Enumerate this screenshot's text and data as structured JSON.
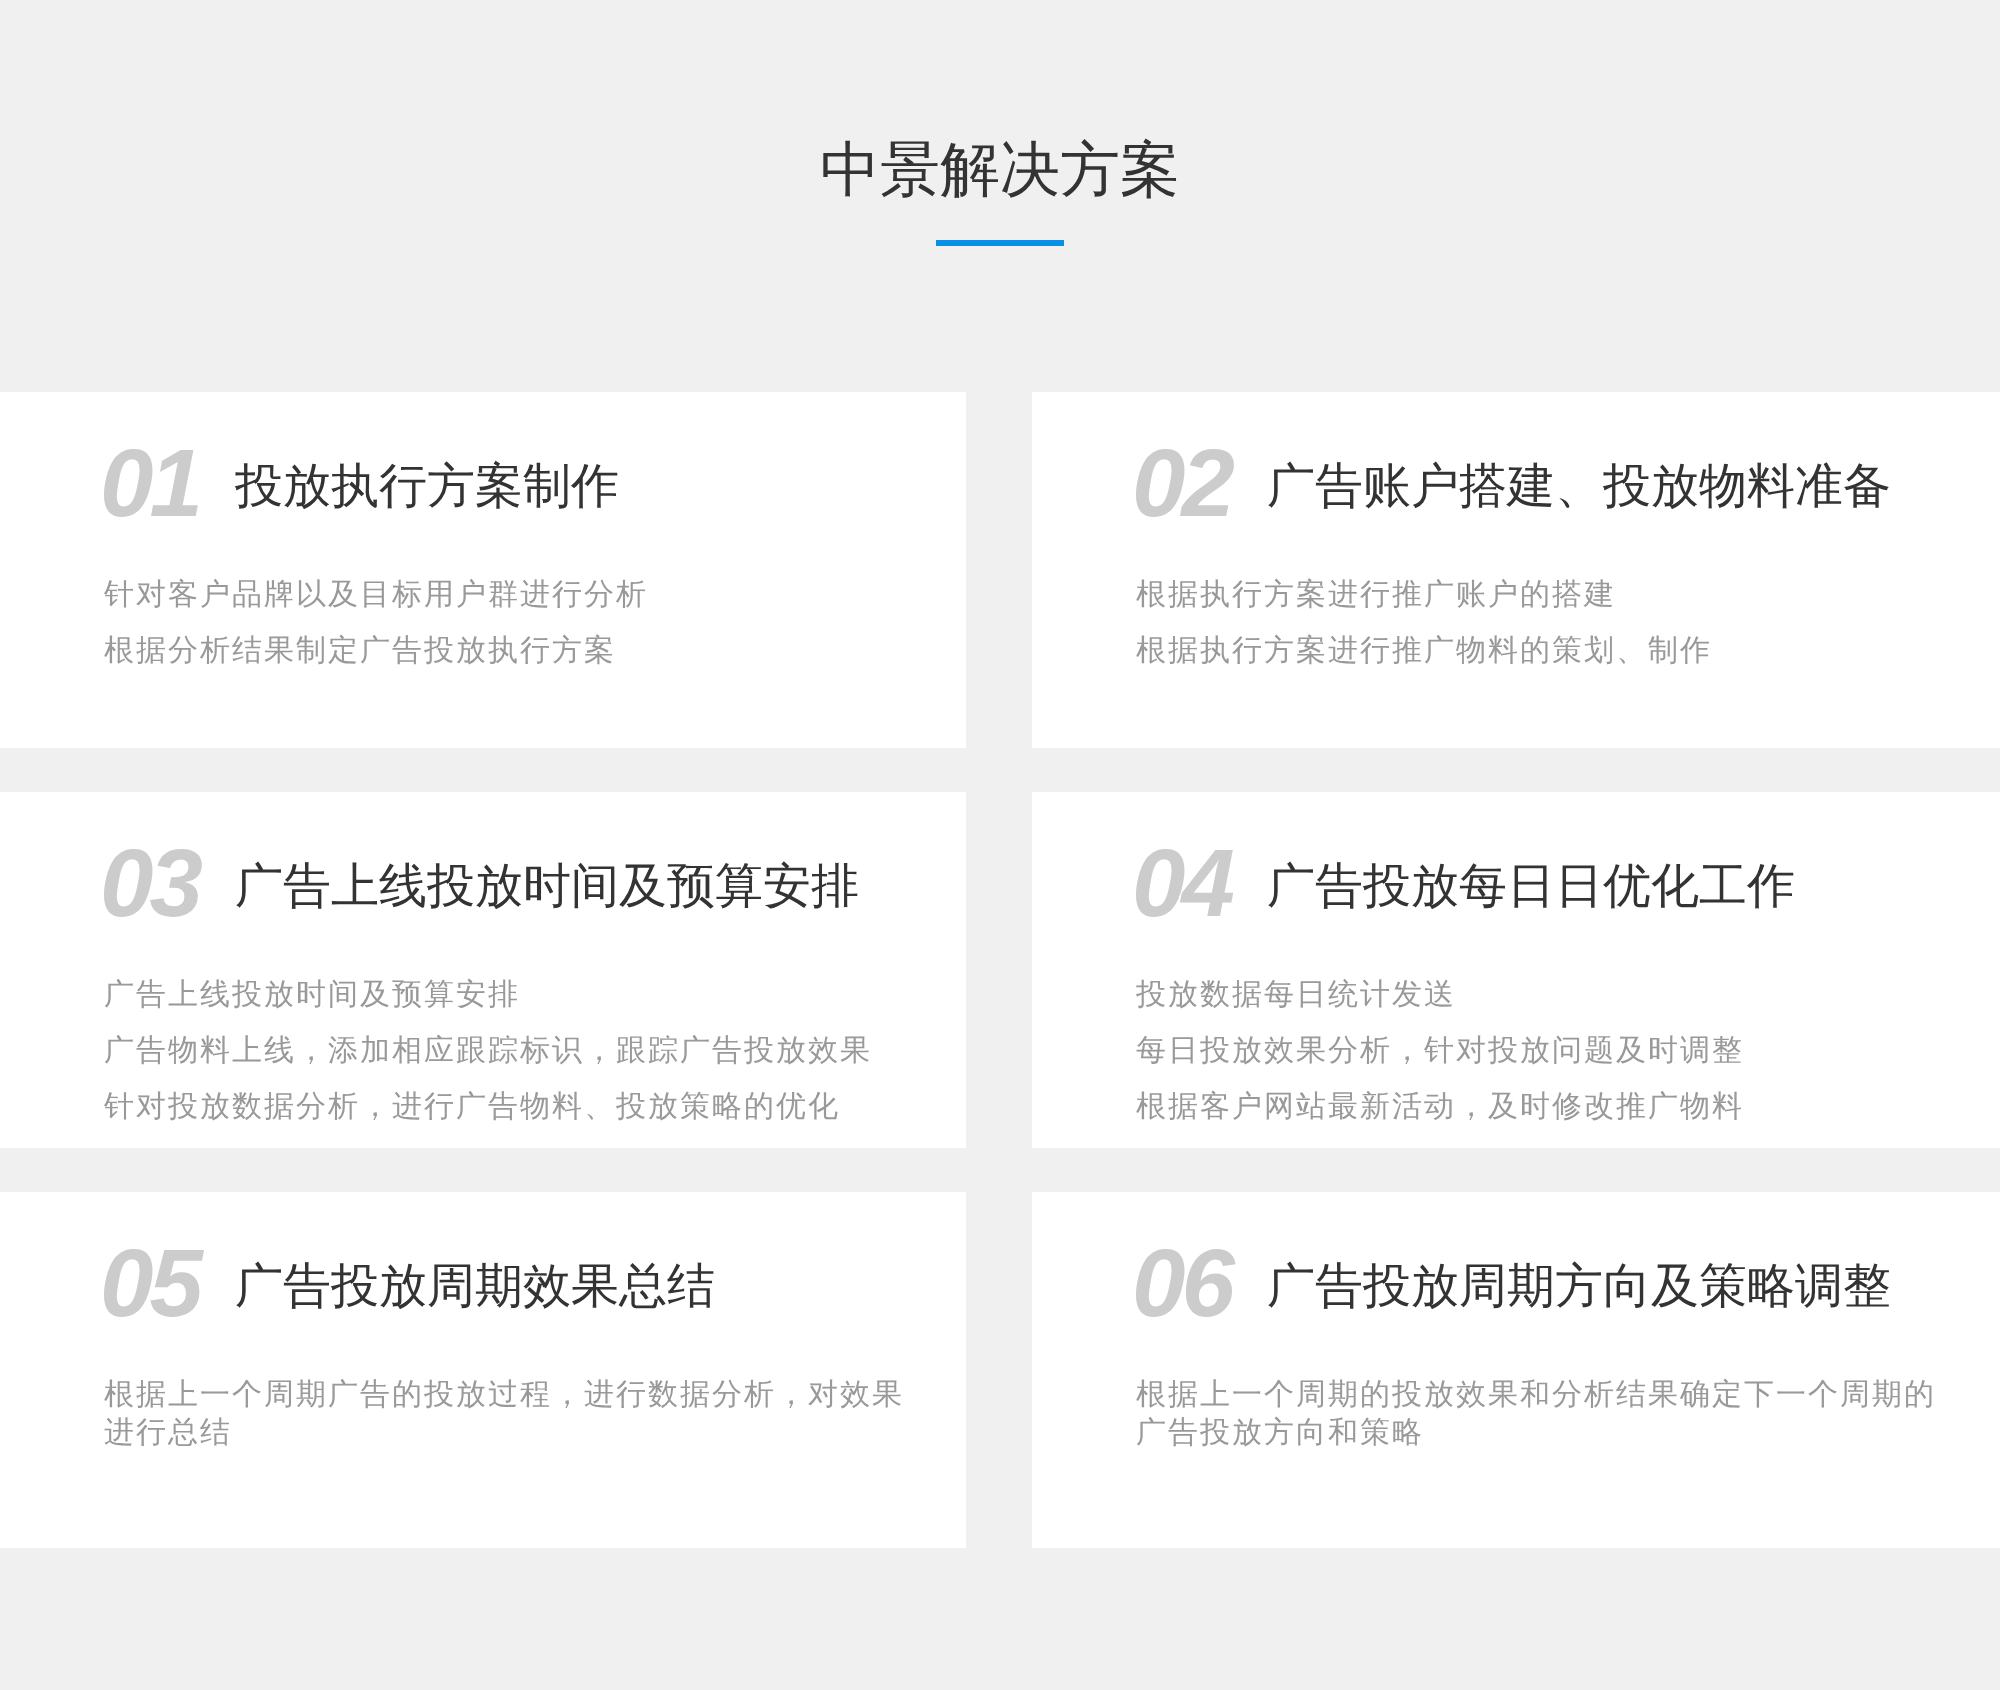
{
  "title": "中景解决方案",
  "cards": [
    {
      "number": "01",
      "heading": "投放执行方案制作",
      "lines": [
        "针对客户品牌以及目标用户群进行分析",
        "根据分析结果制定广告投放执行方案"
      ]
    },
    {
      "number": "02",
      "heading": "广告账户搭建、投放物料准备",
      "lines": [
        "根据执行方案进行推广账户的搭建",
        "根据执行方案进行推广物料的策划、制作"
      ]
    },
    {
      "number": "03",
      "heading": "广告上线投放时间及预算安排",
      "lines": [
        "广告上线投放时间及预算安排",
        "广告物料上线，添加相应跟踪标识，跟踪广告投放效果",
        "针对投放数据分析，进行广告物料、投放策略的优化"
      ]
    },
    {
      "number": "04",
      "heading": "广告投放每日日优化工作",
      "lines": [
        "投放数据每日统计发送",
        "每日投放效果分析，针对投放问题及时调整",
        "根据客户网站最新活动，及时修改推广物料"
      ]
    },
    {
      "number": "05",
      "heading": "广告投放周期效果总结",
      "lines": [
        "根据上一个周期广告的投放过程，进行数据分析，对效果进行总结"
      ]
    },
    {
      "number": "06",
      "heading": "广告投放周期方向及策略调整",
      "lines": [
        "根据上一个周期的投放效果和分析结果确定下一个周期的广告投放方向和策略"
      ]
    }
  ]
}
